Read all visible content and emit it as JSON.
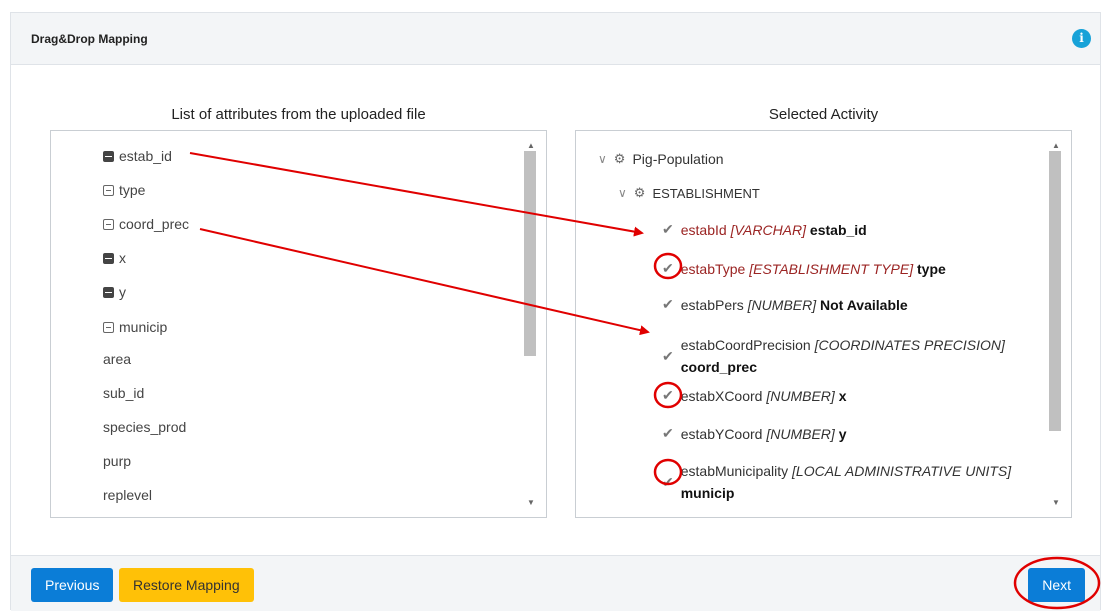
{
  "header": {
    "title": "Drag&Drop Mapping",
    "info_icon": "info-icon",
    "info_glyph": "i"
  },
  "left_panel": {
    "title": "List of attributes from the uploaded file",
    "attributes": [
      {
        "label": "estab_id",
        "icon": "filled-square-icon"
      },
      {
        "label": "type",
        "icon": "empty-square-icon"
      },
      {
        "label": "coord_prec",
        "icon": "empty-square-icon"
      },
      {
        "label": "x",
        "icon": "filled-square-icon"
      },
      {
        "label": "y",
        "icon": "filled-square-icon"
      },
      {
        "label": "municip",
        "icon": "empty-square-icon"
      },
      {
        "label": "area",
        "icon": ""
      },
      {
        "label": "sub_id",
        "icon": ""
      },
      {
        "label": "species_prod",
        "icon": ""
      },
      {
        "label": "purp",
        "icon": ""
      },
      {
        "label": "replevel",
        "icon": ""
      }
    ]
  },
  "right_panel": {
    "title": "Selected Activity",
    "root": {
      "label": "Pig-Population",
      "icon": "gears-icon"
    },
    "group": {
      "label": "ESTABLISHMENT",
      "icon": "gear-icon"
    },
    "fields": [
      {
        "name": "estabId",
        "type": "[VARCHAR]",
        "mapped": "estab_id"
      },
      {
        "name": "estabType",
        "type": "[ESTABLISHMENT TYPE]",
        "mapped": "type"
      },
      {
        "name": "estabPers",
        "type": "[NUMBER]",
        "mapped": "Not Available"
      },
      {
        "name": "estabCoordPrecision",
        "type": "[COORDINATES PRECISION]",
        "mapped": "coord_prec"
      },
      {
        "name": "estabXCoord",
        "type": "[NUMBER]",
        "mapped": "x"
      },
      {
        "name": "estabYCoord",
        "type": "[NUMBER]",
        "mapped": "y"
      },
      {
        "name": "estabMunicipality",
        "type": "[LOCAL ADMINISTRATIVE UNITS]",
        "mapped": "municip"
      }
    ]
  },
  "footer": {
    "previous_label": "Previous",
    "restore_label": "Restore Mapping",
    "next_label": "Next"
  },
  "colors": {
    "primary": "#0b7dd7",
    "warning": "#ffc107",
    "annotation": "#e00000",
    "field": "#9b2423"
  }
}
